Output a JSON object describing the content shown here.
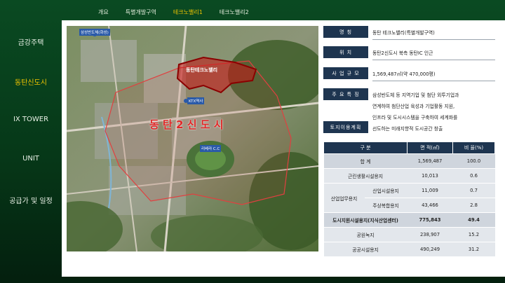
{
  "tabs": [
    "개요",
    "특별개발구역",
    "테크노밸리1",
    "테크노밸리2"
  ],
  "sidebar": [
    "금강주택",
    "동탄신도시",
    "IX TOWER",
    "UNIT",
    "공급가 및 일정"
  ],
  "map": {
    "labels": {
      "samsung": "삼성반도체(화성)",
      "technovalley": "동탄테크노밸리",
      "ktx": "KTX역사",
      "city": "동 탄 2 신 도 시",
      "cc": "리베라 C.C"
    }
  },
  "info": [
    {
      "key": "명          칭",
      "lines": [
        "동탄 테크노밸리(특별개발구역)"
      ]
    },
    {
      "key": "위          치",
      "lines": [
        "동탄2신도시 북측 동탄IC 인근"
      ]
    },
    {
      "key": "사  업  규  모",
      "lines": [
        "1,569,487㎡(약 470,000평)"
      ]
    },
    {
      "key": "주  요  특  징",
      "lines": [
        "삼성반도체 등 지역기업 및 첨단 외투기업과",
        "연계하여 첨단산업 육성과 기업활동 지원,",
        "인프라 및 도시시스템을 구축하여 세계화를",
        "선도하는 미래지향적 도시공간 창출"
      ]
    },
    {
      "key": "토지이용계획",
      "lines": []
    }
  ],
  "stats": {
    "headers": [
      "구  분",
      "면 적(㎡)",
      "비 율(%)"
    ],
    "rows": [
      {
        "group": "합  계",
        "sub": "",
        "area": "1,569,487",
        "ratio": "100.0"
      },
      {
        "group": "근린생활시설용지",
        "sub": "",
        "area": "10,013",
        "ratio": "0.6"
      },
      {
        "group": "산업업무용지",
        "sub": "산업시설용지",
        "area": "11,009",
        "ratio": "0.7"
      },
      {
        "group": "",
        "sub": "주상복합용지",
        "area": "43,466",
        "ratio": "2.8"
      },
      {
        "group": "도시지원시설용지(지식산업센터)",
        "sub": "",
        "area": "775,843",
        "ratio": "49.4"
      },
      {
        "group": "공원녹지",
        "sub": "",
        "area": "238,907",
        "ratio": "15.2"
      },
      {
        "group": "공공시설용지",
        "sub": "",
        "area": "490,249",
        "ratio": "31.2"
      }
    ]
  }
}
